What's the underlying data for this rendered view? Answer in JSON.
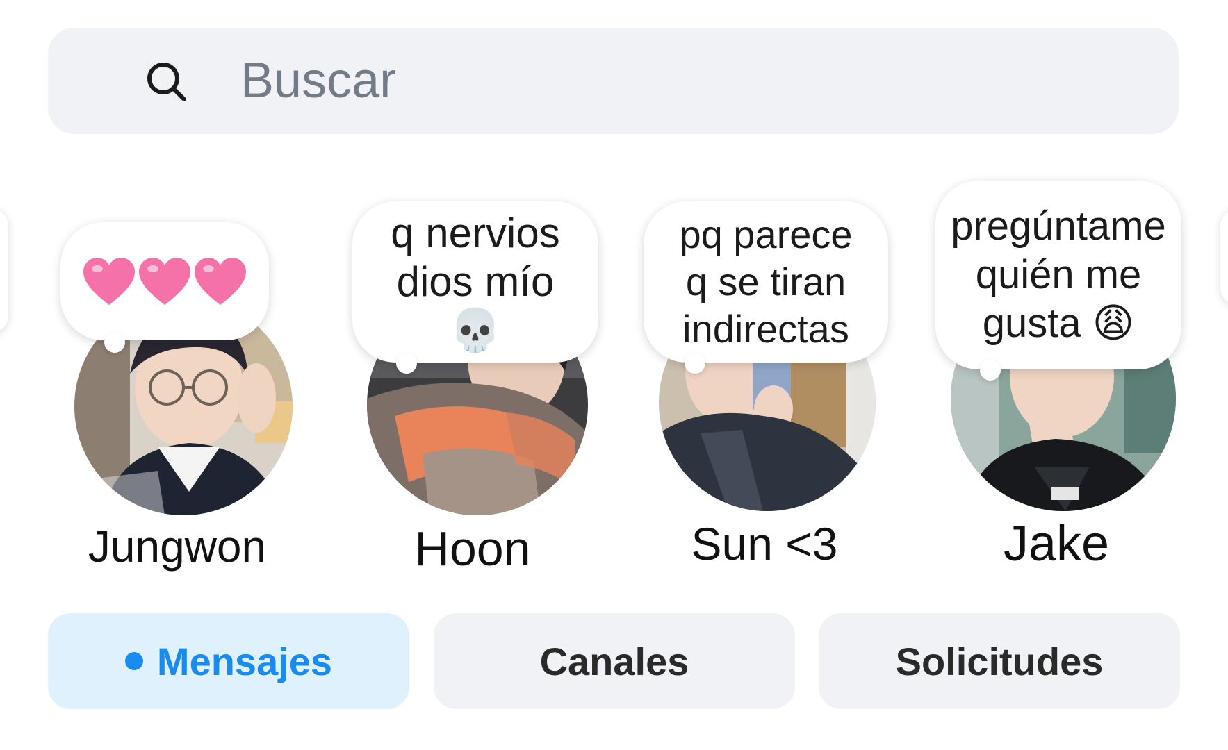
{
  "search": {
    "placeholder": "Buscar",
    "icon": "search-icon"
  },
  "stories": [
    {
      "name": "Jungwon",
      "note": "",
      "note_icon": "heart-icon",
      "note_icon_count": 3,
      "note_icon_color": "#f472a8"
    },
    {
      "name": "Hoon",
      "note": "q nervios\ndios mío\n💀"
    },
    {
      "name": "Sun <3",
      "note": "pq parece\nq se tiran\nindirectas"
    },
    {
      "name": "Jake",
      "note": "pregúntame\nquién me\ngusta 😩"
    }
  ],
  "tabs": [
    {
      "label": "Mensajes",
      "active": true,
      "indicator": "unread-dot-icon"
    },
    {
      "label": "Canales",
      "active": false
    },
    {
      "label": "Solicitudes",
      "active": false
    }
  ],
  "colors": {
    "accent": "#1a8cf0",
    "active_tab_bg": "#e0f1fe",
    "tab_bg": "#f1f2f5",
    "search_bg": "#f1f2f5"
  }
}
